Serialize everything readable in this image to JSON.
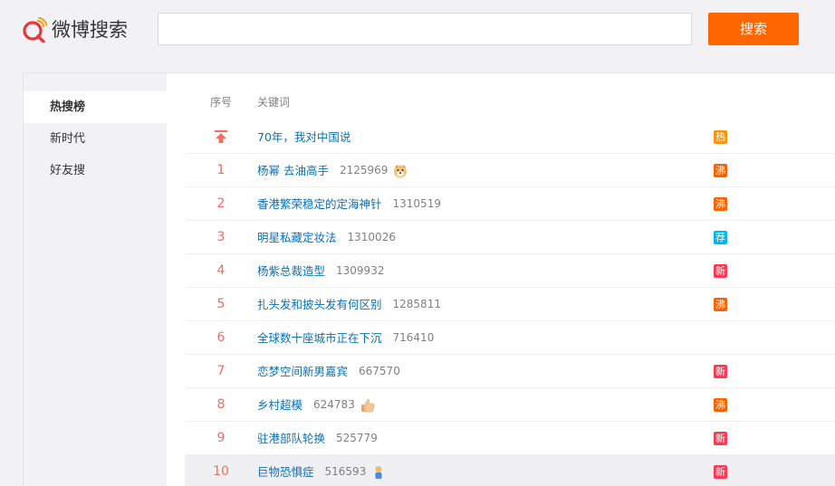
{
  "header": {
    "logo_text": "微博搜索",
    "search_placeholder": "",
    "search_button_label": "搜索"
  },
  "sidebar": {
    "items": [
      {
        "label": "热搜榜",
        "active": true
      },
      {
        "label": "新时代",
        "active": false
      },
      {
        "label": "好友搜",
        "active": false
      }
    ]
  },
  "table": {
    "col_num": "序号",
    "col_keyword": "关键词",
    "rows": [
      {
        "num": "",
        "pinned": true,
        "keyword": "70年，我对中国说",
        "count": "",
        "emoji": "",
        "tag": "热",
        "tag_color": "#ff9406"
      },
      {
        "num": "1",
        "pinned": false,
        "keyword": "杨幂 去油高手",
        "count": "2125969",
        "emoji": "doge-icon",
        "tag": "沸",
        "tag_color": "#f86400"
      },
      {
        "num": "2",
        "pinned": false,
        "keyword": "香港繁荣稳定的定海神针",
        "count": "1310519",
        "emoji": "",
        "tag": "沸",
        "tag_color": "#f86400"
      },
      {
        "num": "3",
        "pinned": false,
        "keyword": "明星私藏定妆法",
        "count": "1310026",
        "emoji": "",
        "tag": "荐",
        "tag_color": "#00b7ee"
      },
      {
        "num": "4",
        "pinned": false,
        "keyword": "杨紫总裁造型",
        "count": "1309932",
        "emoji": "",
        "tag": "新",
        "tag_color": "#ff3852"
      },
      {
        "num": "5",
        "pinned": false,
        "keyword": "扎头发和披头发有何区别",
        "count": "1285811",
        "emoji": "",
        "tag": "沸",
        "tag_color": "#f86400"
      },
      {
        "num": "6",
        "pinned": false,
        "keyword": "全球数十座城市正在下沉",
        "count": "716410",
        "emoji": "",
        "tag": "",
        "tag_color": ""
      },
      {
        "num": "7",
        "pinned": false,
        "keyword": "恋梦空间新男嘉宾",
        "count": "667570",
        "emoji": "",
        "tag": "新",
        "tag_color": "#ff3852"
      },
      {
        "num": "8",
        "pinned": false,
        "keyword": "乡村超模",
        "count": "624783",
        "emoji": "thumbs-up-icon",
        "tag": "沸",
        "tag_color": "#f86400"
      },
      {
        "num": "9",
        "pinned": false,
        "keyword": "驻港部队轮换",
        "count": "525779",
        "emoji": "",
        "tag": "新",
        "tag_color": "#ff3852"
      },
      {
        "num": "10",
        "pinned": false,
        "keyword": "巨物恐惧症",
        "count": "516593",
        "emoji": "figure-icon",
        "tag": "新",
        "tag_color": "#ff3852"
      }
    ]
  }
}
